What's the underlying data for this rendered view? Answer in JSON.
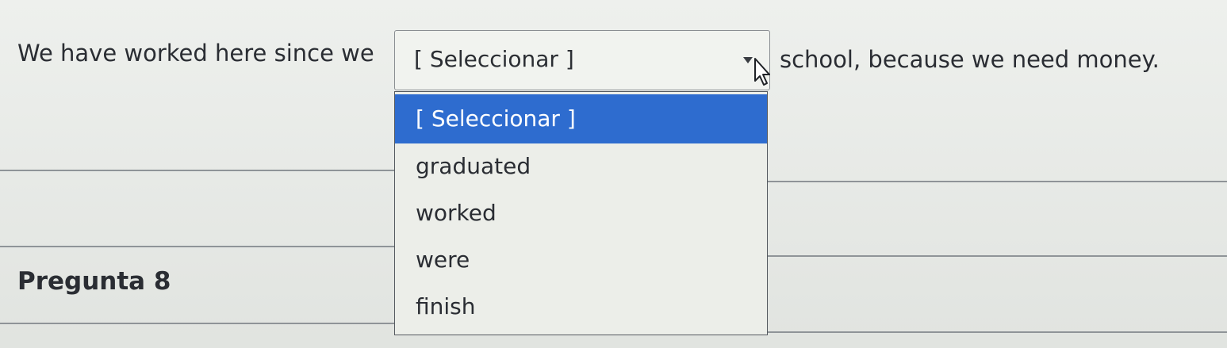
{
  "question": {
    "text_before": "We have worked here since we",
    "text_after": "school, because we need money."
  },
  "select": {
    "current_value": "[ Seleccionar ]",
    "options": [
      {
        "label": "[ Seleccionar ]",
        "highlighted": true
      },
      {
        "label": "graduated",
        "highlighted": false
      },
      {
        "label": "worked",
        "highlighted": false
      },
      {
        "label": "were",
        "highlighted": false
      },
      {
        "label": "finish",
        "highlighted": false
      }
    ]
  },
  "next_question": {
    "label": "Pregunta 8"
  },
  "colors": {
    "highlight": "#2e6ccf",
    "background": "#e8ebe7",
    "text": "#2a2d33"
  },
  "icons": {
    "dropdown_arrow": "chevron-down-icon",
    "cursor": "mouse-pointer-icon"
  }
}
